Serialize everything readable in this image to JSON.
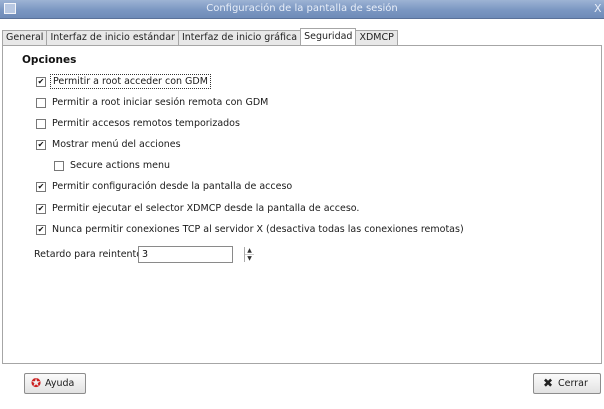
{
  "window": {
    "title": "Configuración de la pantalla de sesión",
    "close_glyph": "X"
  },
  "tabs": [
    {
      "label": "General",
      "active": false
    },
    {
      "label": "Interfaz de inicio estándar",
      "active": false
    },
    {
      "label": "Interfaz de inicio gráfica",
      "active": false
    },
    {
      "label": "Seguridad",
      "active": true
    },
    {
      "label": "XDMCP",
      "active": false
    }
  ],
  "section_title": "Opciones",
  "options": [
    {
      "label": "Permitir a root acceder con GDM",
      "checked": true
    },
    {
      "label": "Permitir a root iniciar sesión remota con GDM",
      "checked": false
    },
    {
      "label": "Permitir accesos remotos temporizados",
      "checked": false
    },
    {
      "label": "Mostrar menú del acciones",
      "checked": true
    },
    {
      "label": "Secure actions menu",
      "checked": false
    },
    {
      "label": "Permitir configuración desde la pantalla de acceso",
      "checked": true
    },
    {
      "label": "Permitir ejecutar el selector XDMCP desde la pantalla de acceso.",
      "checked": true
    },
    {
      "label": "Nunca permitir conexiones TCP al servidor X (desactiva todas las conexiones remotas)",
      "checked": true
    }
  ],
  "retry_delay": {
    "label": "Retardo para reintento (seg):",
    "value": "3"
  },
  "buttons": {
    "help": "Ayuda",
    "close": "Cerrar"
  },
  "colors": {
    "titlebar": "#7b97c2",
    "help_icon": "#cc2222"
  },
  "icons": {
    "help": "lifebuoy-icon",
    "close": "x-mark-icon",
    "spin_up": "arrow-up-icon",
    "spin_down": "arrow-down-icon"
  }
}
